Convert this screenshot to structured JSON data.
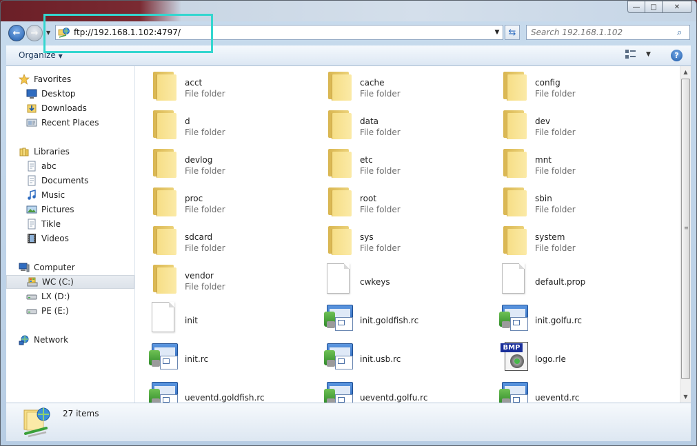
{
  "window": {
    "address": "ftp://192.168.1.102:4797/",
    "search_placeholder": "Search 192.168.1.102"
  },
  "toolbar": {
    "organize_label": "Organize",
    "help_label": "?"
  },
  "nav": {
    "favorites": {
      "label": "Favorites",
      "items": [
        "Desktop",
        "Downloads",
        "Recent Places"
      ]
    },
    "libraries": {
      "label": "Libraries",
      "items": [
        "abc",
        "Documents",
        "Music",
        "Pictures",
        "Tikle",
        "Videos"
      ]
    },
    "computer": {
      "label": "Computer",
      "items": [
        "WC (C:)",
        "LX (D:)",
        "PE (E:)"
      ]
    },
    "network": {
      "label": "Network"
    }
  },
  "files": [
    {
      "name": "acct",
      "type": "File folder",
      "icon": "folder"
    },
    {
      "name": "cache",
      "type": "File folder",
      "icon": "folder"
    },
    {
      "name": "config",
      "type": "File folder",
      "icon": "folder"
    },
    {
      "name": "d",
      "type": "File folder",
      "icon": "folder"
    },
    {
      "name": "data",
      "type": "File folder",
      "icon": "folder"
    },
    {
      "name": "dev",
      "type": "File folder",
      "icon": "folder"
    },
    {
      "name": "devlog",
      "type": "File folder",
      "icon": "folder"
    },
    {
      "name": "etc",
      "type": "File folder",
      "icon": "folder"
    },
    {
      "name": "mnt",
      "type": "File folder",
      "icon": "folder"
    },
    {
      "name": "proc",
      "type": "File folder",
      "icon": "folder"
    },
    {
      "name": "root",
      "type": "File folder",
      "icon": "folder"
    },
    {
      "name": "sbin",
      "type": "File folder",
      "icon": "folder"
    },
    {
      "name": "sdcard",
      "type": "File folder",
      "icon": "folder"
    },
    {
      "name": "sys",
      "type": "File folder",
      "icon": "folder"
    },
    {
      "name": "system",
      "type": "File folder",
      "icon": "folder"
    },
    {
      "name": "vendor",
      "type": "File folder",
      "icon": "folder"
    },
    {
      "name": "cwkeys",
      "type": "",
      "icon": "document"
    },
    {
      "name": "default.prop",
      "type": "",
      "icon": "document"
    },
    {
      "name": "init",
      "type": "",
      "icon": "document"
    },
    {
      "name": "init.goldfish.rc",
      "type": "",
      "icon": "rc-file"
    },
    {
      "name": "init.golfu.rc",
      "type": "",
      "icon": "rc-file"
    },
    {
      "name": "init.rc",
      "type": "",
      "icon": "rc-file"
    },
    {
      "name": "init.usb.rc",
      "type": "",
      "icon": "rc-file"
    },
    {
      "name": "logo.rle",
      "type": "",
      "icon": "bmp-file"
    },
    {
      "name": "ueventd.goldfish.rc",
      "type": "",
      "icon": "rc-file"
    },
    {
      "name": "ueventd.golfu.rc",
      "type": "",
      "icon": "rc-file"
    },
    {
      "name": "ueventd.rc",
      "type": "",
      "icon": "rc-file"
    }
  ],
  "status": {
    "item_count": "27 items"
  },
  "colors": {
    "highlight": "#34d6cf",
    "folder": "#f6de86",
    "accent": "#1f5bab"
  }
}
